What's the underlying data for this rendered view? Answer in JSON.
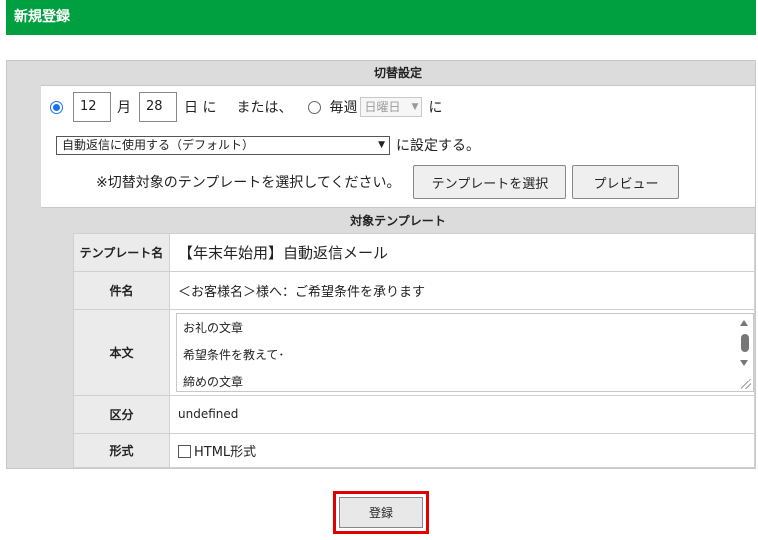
{
  "header": {
    "title": "新規登録"
  },
  "switch_settings": {
    "heading": "切替設定",
    "month_value": "12",
    "month_unit": "月",
    "day_value": "28",
    "day_unit": "日 に",
    "or_text": "または、",
    "weekly_label": "毎週",
    "weekday_select": "日曜日",
    "weekly_suffix": "に",
    "usage_select": "自動返信に使用する（デフォルト）",
    "usage_suffix": "に設定する。",
    "instruction": "※切替対象のテンプレートを選択してください。",
    "select_template_button": "テンプレートを選択",
    "preview_button": "プレビュー"
  },
  "target_template": {
    "heading": "対象テンプレート",
    "rows": {
      "name_label": "テンプレート名",
      "name_value": "【年末年始用】自動返信メール",
      "subject_label": "件名",
      "subject_value": "＜お客様名＞様へ：ご希望条件を承ります",
      "body_label": "本文",
      "body_lines": [
        "お礼の文章",
        "希望条件を教えて･",
        "締めの文章"
      ],
      "category_label": "区分",
      "category_value": "undefined",
      "format_label": "形式",
      "format_value": "HTML形式"
    }
  },
  "submit_button": "登録"
}
